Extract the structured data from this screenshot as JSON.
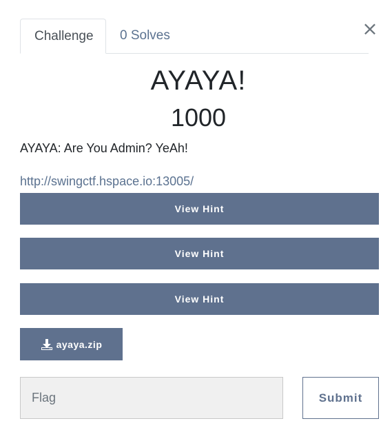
{
  "tabs": {
    "challenge": "Challenge",
    "solves": "0 Solves"
  },
  "close_symbol": "×",
  "challenge": {
    "name": "AYAYA!",
    "points": "1000",
    "description": "AYAYA: Are You Admin? YeAh!",
    "link": "http://swingctf.hspace.io:13005/"
  },
  "hints": [
    {
      "label": "View Hint"
    },
    {
      "label": "View Hint"
    },
    {
      "label": "View Hint"
    }
  ],
  "file": {
    "label": "ayaya.zip",
    "icon": "download-icon"
  },
  "form": {
    "flag_placeholder": "Flag",
    "flag_value": "",
    "submit_label": "Submit"
  },
  "colors": {
    "button_bg": "#5f718e",
    "link": "#5b7290",
    "input_bg": "#f0f0f0"
  }
}
